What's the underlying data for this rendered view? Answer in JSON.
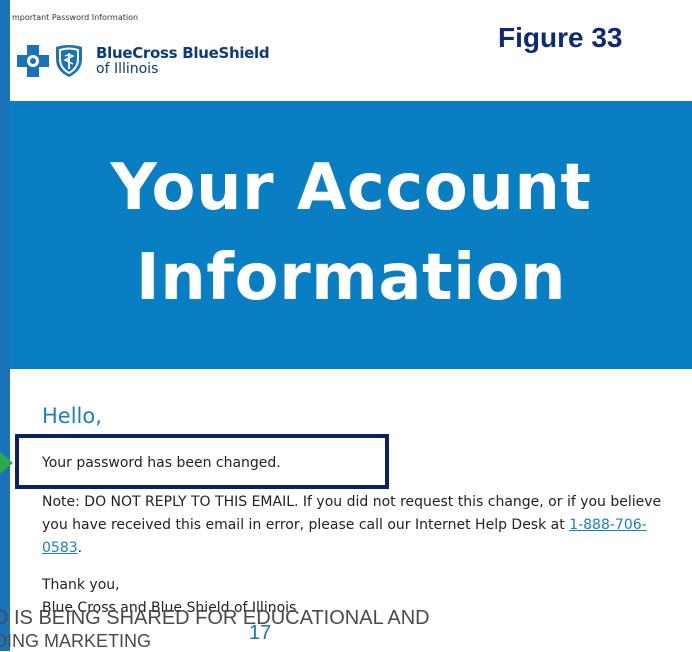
{
  "email": {
    "preheader": "mportant Password Information",
    "logo": {
      "name": "BlueCross BlueShield",
      "state": "of Illinois",
      "icons": [
        "bluecross-icon",
        "blueshield-icon"
      ]
    },
    "hero": {
      "line1": "Your Account",
      "line2": "Information"
    },
    "greeting": "Hello,",
    "message": "Your password has been changed.",
    "note": {
      "text": "Note: DO NOT REPLY TO THIS EMAIL. If you did not request this change, or if you believe you have received this email in error, please call our Internet Help Desk at ",
      "phone": "1-888-706-0583",
      "end": "."
    },
    "closing": "Thank you,",
    "signature": "Blue Cross and Blue Shield of Illinois"
  },
  "slide": {
    "figure_label": "Figure 33",
    "footer_line1": "D IS BEING SHARED FOR EDUCATIONAL AND",
    "footer_line2": "DING MARKETING",
    "page_number": "17"
  },
  "colors": {
    "hero_background": "#0a7ec2",
    "brand_navy": "#0c3b7a",
    "link_blue": "#1a7fc0",
    "highlight_border": "#0d2060",
    "arrow_green": "#2ea84f",
    "slide_accent": "#1a73b8"
  }
}
